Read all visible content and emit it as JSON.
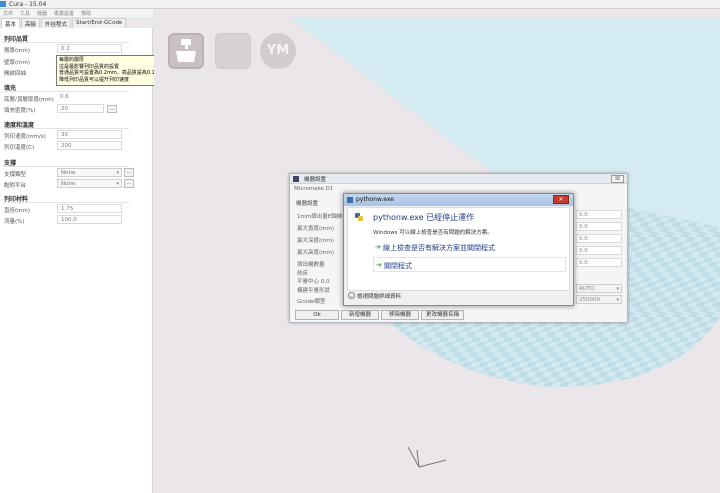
{
  "window": {
    "title": "Cura - 15.04"
  },
  "menu": [
    "文件",
    "工具",
    "機器",
    "專業設置",
    "幫助"
  ],
  "tabs": [
    "基本",
    "高級",
    "外挂程式",
    "Start/End-GCode"
  ],
  "sections": {
    "quality": "列印品質",
    "fill": "填充",
    "speed_temp": "速度和溫度",
    "support": "支撐",
    "filament": "列印材料"
  },
  "fields": {
    "layer_height": {
      "label": "層厚(mm)",
      "value": "0.2"
    },
    "shell": {
      "label": "壁厚(mm)"
    },
    "retraction": {
      "label": "開啟回抽"
    },
    "top_bottom": {
      "label": "底層/頂層厚度(mm)",
      "value": "0.6"
    },
    "fill_density": {
      "label": "填充密度(%)",
      "value": "20",
      "button": "..."
    },
    "print_speed": {
      "label": "列印速度(mm/s)",
      "value": "30"
    },
    "print_temp": {
      "label": "列印溫度(C)",
      "value": "200"
    },
    "support_type": {
      "label": "支撐類型",
      "value": "None",
      "button": "..."
    },
    "platform_adhesion": {
      "label": "黏附平台",
      "value": "None",
      "button": "..."
    },
    "diameter": {
      "label": "直徑(mm)",
      "value": "1.75"
    },
    "flow": {
      "label": "流量(%)",
      "value": "100.0"
    }
  },
  "tooltip": {
    "line1": "每層的層厚",
    "line2": "這是最影響列印品質的設置",
    "line3": "普通品質可設置為0.2mm，高品質設為0.1mm，",
    "line4": "降低列印品質可以提升列印速度"
  },
  "toolbar": {
    "ym_label": "YM"
  },
  "machine_dialog": {
    "title": "機器設置",
    "close_label": "☒",
    "subtab": "Micromake D1",
    "group": "機器設置",
    "rows": [
      {
        "label": "1mm擠出量E軸機",
        "value": "0.0"
      },
      {
        "label": "最大寬度(mm)",
        "value": "0.0"
      },
      {
        "label": "最大深度(mm)",
        "value": "0.0"
      },
      {
        "label": "最大高度(mm)",
        "value": "0.0"
      },
      {
        "label": "擠出機數量",
        "value": "0.0"
      },
      {
        "label": "熱床"
      },
      {
        "label": "平臺中心 0,0"
      },
      {
        "label": "構建平臺形狀",
        "value": "AUTO"
      },
      {
        "label": "Gcode類型",
        "value": "250000"
      }
    ],
    "buttons": [
      "Ok",
      "新增機器",
      "移除機器",
      "更改機器名稱"
    ]
  },
  "error_dialog": {
    "title": "pythonw.exe",
    "close_label": "✕",
    "headline": "pythonw.exe 已經停止運作",
    "description": "Windows 可以線上檢查是否有問題的解決方案。",
    "option1": "線上檢查是否有解決方案並關閉程式",
    "option2": "關閉程式",
    "details": "檢視問題詳細資料",
    "arrow_glyph": "➔",
    "chevron_glyph": "⌄"
  },
  "colors": {
    "viewport_bg": "#ebe6ea",
    "build_plate": "#d4ebf1",
    "error_headline": "#1e3d8a"
  }
}
